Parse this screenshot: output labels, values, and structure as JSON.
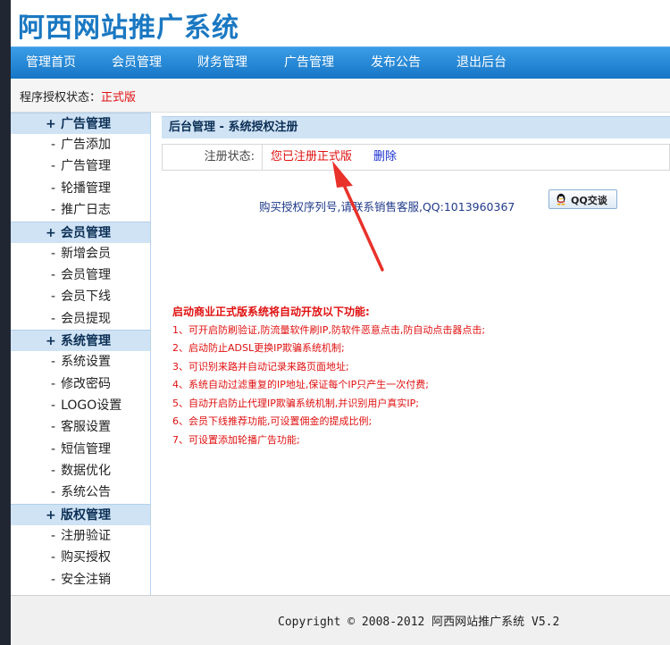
{
  "header": {
    "site_title": "阿西网站推广系统"
  },
  "topnav": {
    "items": [
      {
        "label": "管理首页"
      },
      {
        "label": "会员管理"
      },
      {
        "label": "财务管理"
      },
      {
        "label": "广告管理"
      },
      {
        "label": "发布公告"
      },
      {
        "label": "退出后台"
      }
    ]
  },
  "status": {
    "label": "程序授权状态：",
    "value": "正式版"
  },
  "sidebar": {
    "groups": [
      {
        "label": "广告管理",
        "items": [
          "广告添加",
          "广告管理",
          "轮播管理",
          "推广日志"
        ]
      },
      {
        "label": "会员管理",
        "items": [
          "新增会员",
          "会员管理",
          "会员下线",
          "会员提现"
        ]
      },
      {
        "label": "系统管理",
        "items": [
          "系统设置",
          "修改密码",
          "LOGO设置",
          "客服设置",
          "短信管理",
          "数据优化",
          "系统公告"
        ]
      },
      {
        "label": "版权管理",
        "items": [
          "注册验证",
          "购买授权",
          "安全注销"
        ]
      }
    ]
  },
  "content": {
    "heading": "后台管理 - 系统授权注册",
    "reg_label": "注册状态:",
    "reg_value": "您已注册正式版",
    "delete_label": "删除",
    "buy_text": "购买授权序列号,请联系销售客服,QQ:1013960367",
    "qq_button": "QQ交谈",
    "features_title": "启动商业正式版系统将自动开放以下功能:",
    "features": [
      "1、可开启防刷验证,防流量软件刷IP,防软件恶意点击,防自动点击器点击;",
      "2、启动防止ADSL更换IP欺骗系统机制;",
      "3、可识别来路并自动记录来路页面地址;",
      "4、系统自动过滤重复的IP地址,保证每个IP只产生一次付费;",
      "5、自动开启防止代理IP欺骗系统机制,并识别用户真实IP;",
      "6、会员下线推荐功能,可设置佣金的提成比例;",
      "7、可设置添加轮播广告功能;"
    ]
  },
  "footer": {
    "copyright": "Copyright © 2008-2012 阿西网站推广系统 V5.2"
  },
  "colors": {
    "brand_blue": "#1a78c2",
    "nav_blue": "#1676c6",
    "highlight_red": "#e01010",
    "sidebar_group_bg": "#cfe3f5"
  }
}
